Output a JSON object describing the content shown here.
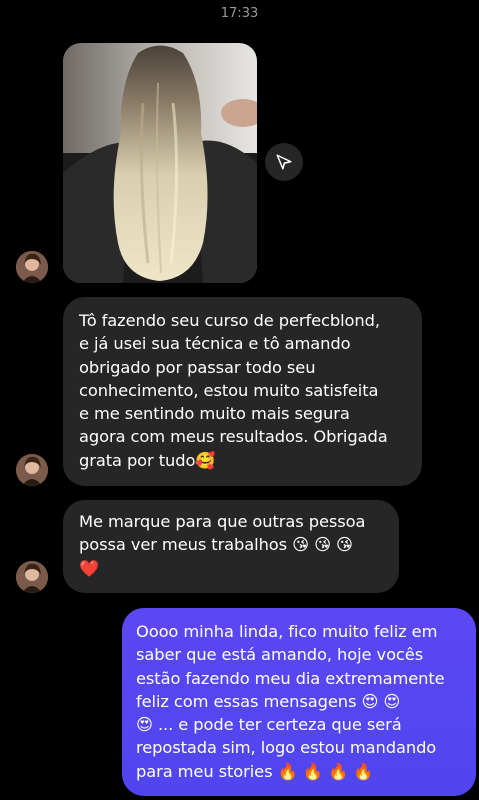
{
  "status_time": "17:33",
  "messages": {
    "m1": {
      "lines": [
        "Tô fazendo seu curso de perfecblond,",
        "e já usei sua técnica e tô amando",
        "obrigado por passar todo seu",
        "conhecimento, estou muito satisfeita",
        "e me sentindo muito mais segura",
        "agora com meus resultados. Obrigada",
        "grata por tudo🥰"
      ]
    },
    "m2": {
      "lines": [
        "Me marque para que outras pessoa",
        "possa ver meus trabalhos 😘 😘 😘",
        "❤️"
      ]
    },
    "m3": {
      "lines": [
        "Oooo minha linda, fico muito feliz em",
        "saber que está amando, hoje vocês",
        "estão fazendo meu dia extremamente",
        "feliz com essas mensagens 😍 😍",
        "😍 ... e pode ter certeza que será",
        "repostada sim, logo estou mandando",
        "para meu stories 🔥 🔥 🔥 🔥"
      ]
    }
  },
  "colors": {
    "incoming_bubble": "#262626",
    "outgoing_bubble": "#5548f0",
    "background": "#000000"
  },
  "icons": {
    "share": "paper-plane-icon"
  }
}
